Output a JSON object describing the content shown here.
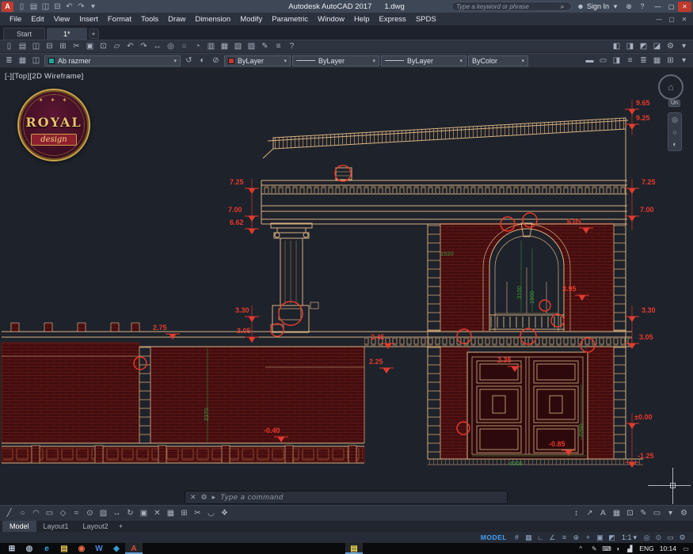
{
  "colors": {
    "accent_blue": "#42a1f5",
    "dim_red": "#e8392b",
    "dim_green": "#3f9b42",
    "line_tan": "#d8b383",
    "brick_red": "#4a0d10",
    "close_button": "#c0392b",
    "layer_chip": "#27a39a",
    "color_chip": "#c23b2f"
  },
  "icons": {
    "caret": "▾",
    "minimize": "—",
    "maximize": "▢",
    "close": "✕",
    "search": "⌕",
    "user": "☻",
    "exchange": "⊗",
    "help": "?",
    "plus": "+",
    "tray_chevron": "^"
  },
  "titlebar": {
    "app_title": "Autodesk AutoCAD 2017",
    "doc_title": "1.dwg",
    "search_placeholder": "Type a keyword or phrase",
    "signin_label": "Sign In",
    "qat_icons": [
      {
        "name": "new-file-icon",
        "glyph": "▯"
      },
      {
        "name": "open-file-icon",
        "glyph": "▤"
      },
      {
        "name": "save-file-icon",
        "glyph": "◫"
      },
      {
        "name": "plot-icon",
        "glyph": "⊟"
      },
      {
        "name": "undo-icon",
        "glyph": "↶"
      },
      {
        "name": "redo-icon",
        "glyph": "↷"
      },
      {
        "name": "qat-menu-icon",
        "glyph": "▾"
      }
    ]
  },
  "menubar": {
    "items": [
      {
        "name": "menu-file",
        "label": "File"
      },
      {
        "name": "menu-edit",
        "label": "Edit"
      },
      {
        "name": "menu-view",
        "label": "View"
      },
      {
        "name": "menu-insert",
        "label": "Insert"
      },
      {
        "name": "menu-format",
        "label": "Format"
      },
      {
        "name": "menu-tools",
        "label": "Tools"
      },
      {
        "name": "menu-draw",
        "label": "Draw"
      },
      {
        "name": "menu-dimension",
        "label": "Dimension"
      },
      {
        "name": "menu-modify",
        "label": "Modify"
      },
      {
        "name": "menu-parametric",
        "label": "Parametric"
      },
      {
        "name": "menu-window",
        "label": "Window"
      },
      {
        "name": "menu-help",
        "label": "Help"
      },
      {
        "name": "menu-express",
        "label": "Express"
      },
      {
        "name": "menu-spds",
        "label": "SPDS"
      }
    ]
  },
  "doc_tabs": {
    "start_label": "Start",
    "drawing_label": "1*"
  },
  "toolbar_standard": {
    "icons": [
      {
        "name": "new-file-icon",
        "glyph": "▯"
      },
      {
        "name": "open-file-icon",
        "glyph": "▤"
      },
      {
        "name": "save-file-icon",
        "glyph": "◫"
      },
      {
        "name": "plot-icon",
        "glyph": "⊟"
      },
      {
        "name": "plot-preview-icon",
        "glyph": "⊞"
      },
      {
        "name": "cut-icon",
        "glyph": "✂"
      },
      {
        "name": "copy-icon",
        "glyph": "▣"
      },
      {
        "name": "paste-icon",
        "glyph": "⊡"
      },
      {
        "name": "match-properties-icon",
        "glyph": "▱"
      },
      {
        "name": "undo-icon",
        "glyph": "↶"
      },
      {
        "name": "redo-icon",
        "glyph": "↷"
      },
      {
        "name": "pan-icon",
        "glyph": "↔"
      },
      {
        "name": "zoom-realtime-icon",
        "glyph": "◎"
      },
      {
        "name": "zoom-window-icon",
        "glyph": "○"
      },
      {
        "name": "zoom-previous-icon",
        "glyph": "◔"
      },
      {
        "name": "properties-icon",
        "glyph": "▥"
      },
      {
        "name": "designcenter-icon",
        "glyph": "▦"
      },
      {
        "name": "tool-palettes-icon",
        "glyph": "▧"
      },
      {
        "name": "sheet-set-icon",
        "glyph": "▨"
      },
      {
        "name": "markup-icon",
        "glyph": "✎"
      },
      {
        "name": "quick-calc-icon",
        "glyph": "≡"
      },
      {
        "name": "help-icon",
        "glyph": "?"
      }
    ],
    "right_icons": [
      {
        "name": "draworder-front-icon",
        "glyph": "◧"
      },
      {
        "name": "draworder-back-icon",
        "glyph": "◨"
      },
      {
        "name": "draworder-above-icon",
        "glyph": "◩"
      },
      {
        "name": "draworder-below-icon",
        "glyph": "◪"
      },
      {
        "name": "options-icon",
        "glyph": "⚙"
      },
      {
        "name": "more-icon",
        "glyph": "▾"
      }
    ]
  },
  "toolbar_layers": {
    "left_icons": [
      {
        "name": "layer-properties-icon",
        "glyph": "≣"
      },
      {
        "name": "layer-filter-icon",
        "glyph": "▦"
      },
      {
        "name": "layer-states-icon",
        "glyph": "◫"
      }
    ],
    "layer_value": "Ab razmer",
    "mid_icons": [
      {
        "name": "layer-previous-icon",
        "glyph": "↺"
      },
      {
        "name": "layer-isolate-icon",
        "glyph": "◐"
      },
      {
        "name": "layer-off-icon",
        "glyph": "⊘"
      }
    ],
    "color_value": "ByLayer",
    "linetype_value": "ByLayer",
    "lineweight_value": "ByLayer",
    "plotstyle_value": "ByColor",
    "right_icons": [
      {
        "name": "make-object-layer-icon",
        "glyph": "▬"
      },
      {
        "name": "layer-walk-icon",
        "glyph": "▭"
      },
      {
        "name": "match-layer-icon",
        "glyph": "◨"
      },
      {
        "name": "properties-toggle-icon",
        "glyph": "≡"
      },
      {
        "name": "list-view-icon",
        "glyph": "≣"
      },
      {
        "name": "group-panel-icon",
        "glyph": "▦"
      },
      {
        "name": "panel-expand-icon",
        "glyph": "⊞"
      },
      {
        "name": "more-icon",
        "glyph": "▾"
      }
    ]
  },
  "canvas": {
    "viewport_label": "[-][Top][2D Wireframe]",
    "viewcube_label": "Un",
    "viewcube_home_icon": "⌂",
    "logo": {
      "title": "ROYAL",
      "subtitle": "design",
      "ornament": "✦ ✦ ✦"
    },
    "navbar_icons": [
      {
        "name": "steering-wheel-icon",
        "glyph": "◎"
      },
      {
        "name": "pan-hand-icon",
        "glyph": "○"
      },
      {
        "name": "orbit-icon",
        "glyph": "◐"
      }
    ],
    "elevation_marks": {
      "left": [
        "7.25",
        "7.00",
        "6.62",
        "3.30",
        "3.05"
      ],
      "right": [
        "9.65",
        "9.25",
        "7.25",
        "7.00",
        "3.30",
        "3.05",
        "±0.00",
        "-1.25"
      ],
      "inner": [
        "2.75",
        "2.45",
        "2.25",
        "-0.40",
        "2.35",
        "-0.85",
        "6.05",
        "3.95"
      ],
      "green": [
        "1520",
        "3100",
        "1500",
        "2370",
        "2200",
        "4000"
      ]
    }
  },
  "command_line": {
    "close_icon": "✕",
    "customize_icon": "⚙",
    "prompt_icon": "▸",
    "prompt": "Type a command"
  },
  "bottom_toolbar": {
    "left_icons": [
      {
        "name": "draw-line-icon",
        "glyph": "╱"
      },
      {
        "name": "draw-circle-icon",
        "glyph": "○"
      },
      {
        "name": "draw-arc-icon",
        "glyph": "◠"
      },
      {
        "name": "draw-rect-icon",
        "glyph": "▭"
      },
      {
        "name": "draw-polygon-icon",
        "glyph": "◇"
      },
      {
        "name": "draw-spline-icon",
        "glyph": "≈"
      },
      {
        "name": "draw-ellipse-icon",
        "glyph": "⊙"
      },
      {
        "name": "draw-hatch-icon",
        "glyph": "▨"
      },
      {
        "name": "move-icon",
        "glyph": "↔"
      },
      {
        "name": "rotate-icon",
        "glyph": "↻"
      },
      {
        "name": "copy-object-icon",
        "glyph": "▣"
      },
      {
        "name": "erase-icon",
        "glyph": "✕"
      },
      {
        "name": "array-icon",
        "glyph": "▦"
      },
      {
        "name": "offset-icon",
        "glyph": "⊞"
      },
      {
        "name": "trim-icon",
        "glyph": "✂"
      },
      {
        "name": "fillet-icon",
        "glyph": "◡"
      },
      {
        "name": "explode-icon",
        "glyph": "❖"
      }
    ],
    "right_icons": [
      {
        "name": "dim-linear-icon",
        "glyph": "↕"
      },
      {
        "name": "leader-icon",
        "glyph": "↗"
      },
      {
        "name": "text-icon",
        "glyph": "A"
      },
      {
        "name": "table-icon",
        "glyph": "▦"
      },
      {
        "name": "insert-block-icon",
        "glyph": "⊡"
      },
      {
        "name": "edit-polyline-icon",
        "glyph": "✎"
      },
      {
        "name": "region-icon",
        "glyph": "▭"
      },
      {
        "name": "toolbar-menu-icon",
        "glyph": "▾"
      },
      {
        "name": "settings-icon",
        "glyph": "⚙"
      }
    ]
  },
  "layout_bar": {
    "tabs": [
      {
        "name": "tab-model",
        "label": "Model",
        "active": true
      },
      {
        "name": "tab-layout1",
        "label": "Layout1"
      },
      {
        "name": "tab-layout2",
        "label": "Layout2"
      }
    ]
  },
  "statusbar": {
    "model_label": "MODEL",
    "icons": [
      {
        "name": "grid-icon",
        "gly ph_bad": "",
        "glyph": "#"
      },
      {
        "name": "snap-icon",
        "glyph": "▦"
      },
      {
        "name": "ortho-icon",
        "glyph": "∟"
      },
      {
        "name": "polar-icon",
        "glyph": "∠"
      },
      {
        "name": "osnap-icon",
        "glyph": "≡"
      },
      {
        "name": "otrack-icon",
        "glyph": "⊕"
      },
      {
        "name": "dynamic-input-icon",
        "glyph": "+"
      },
      {
        "name": "lineweight-icon",
        "glyph": "▣"
      },
      {
        "name": "transparency-icon",
        "glyph": "◩"
      }
    ],
    "scale_label": "1:1",
    "icons2": [
      {
        "name": "isolate-objects-icon",
        "glyph": "◎"
      },
      {
        "name": "hardware-accel-icon",
        "glyph": "⊙"
      },
      {
        "name": "clean-screen-icon",
        "glyph": "▭"
      },
      {
        "name": "customization-icon",
        "glyph": "⚙"
      }
    ]
  },
  "taskbar": {
    "apps": [
      {
        "name": "start-button",
        "glyph": "⊞",
        "color": "#cfe3f5"
      },
      {
        "name": "cortana-icon",
        "glyph": "◍",
        "color": "#9fb2c0"
      },
      {
        "name": "edge-icon",
        "glyph": "e",
        "color": "#38a3e6"
      },
      {
        "name": "file-explorer-icon",
        "glyph": "▤",
        "color": "#e9c34d"
      },
      {
        "name": "browser-icon",
        "glyph": "◉",
        "color": "#e56a3d"
      },
      {
        "name": "word-icon",
        "glyph": "W",
        "color": "#4f86e0"
      },
      {
        "name": "telegram-icon",
        "glyph": "◈",
        "color": "#36a6dc"
      },
      {
        "name": "autocad-icon",
        "glyph": "A",
        "color": "#e0483a",
        "active": true
      },
      {
        "name": "drawing-app-icon",
        "glyph": "▤",
        "color": "#ecd44e",
        "active": true
      }
    ],
    "tray_icons": [
      {
        "name": "pen-icon",
        "glyph": "✎"
      },
      {
        "name": "keyboard-icon",
        "glyph": "⌨"
      },
      {
        "name": "volume-icon",
        "glyph": "◖"
      },
      {
        "name": "network-icon",
        "glyph": "▟"
      }
    ],
    "lang": "ENG",
    "time": "10:14",
    "notification_glyph": "▭"
  }
}
